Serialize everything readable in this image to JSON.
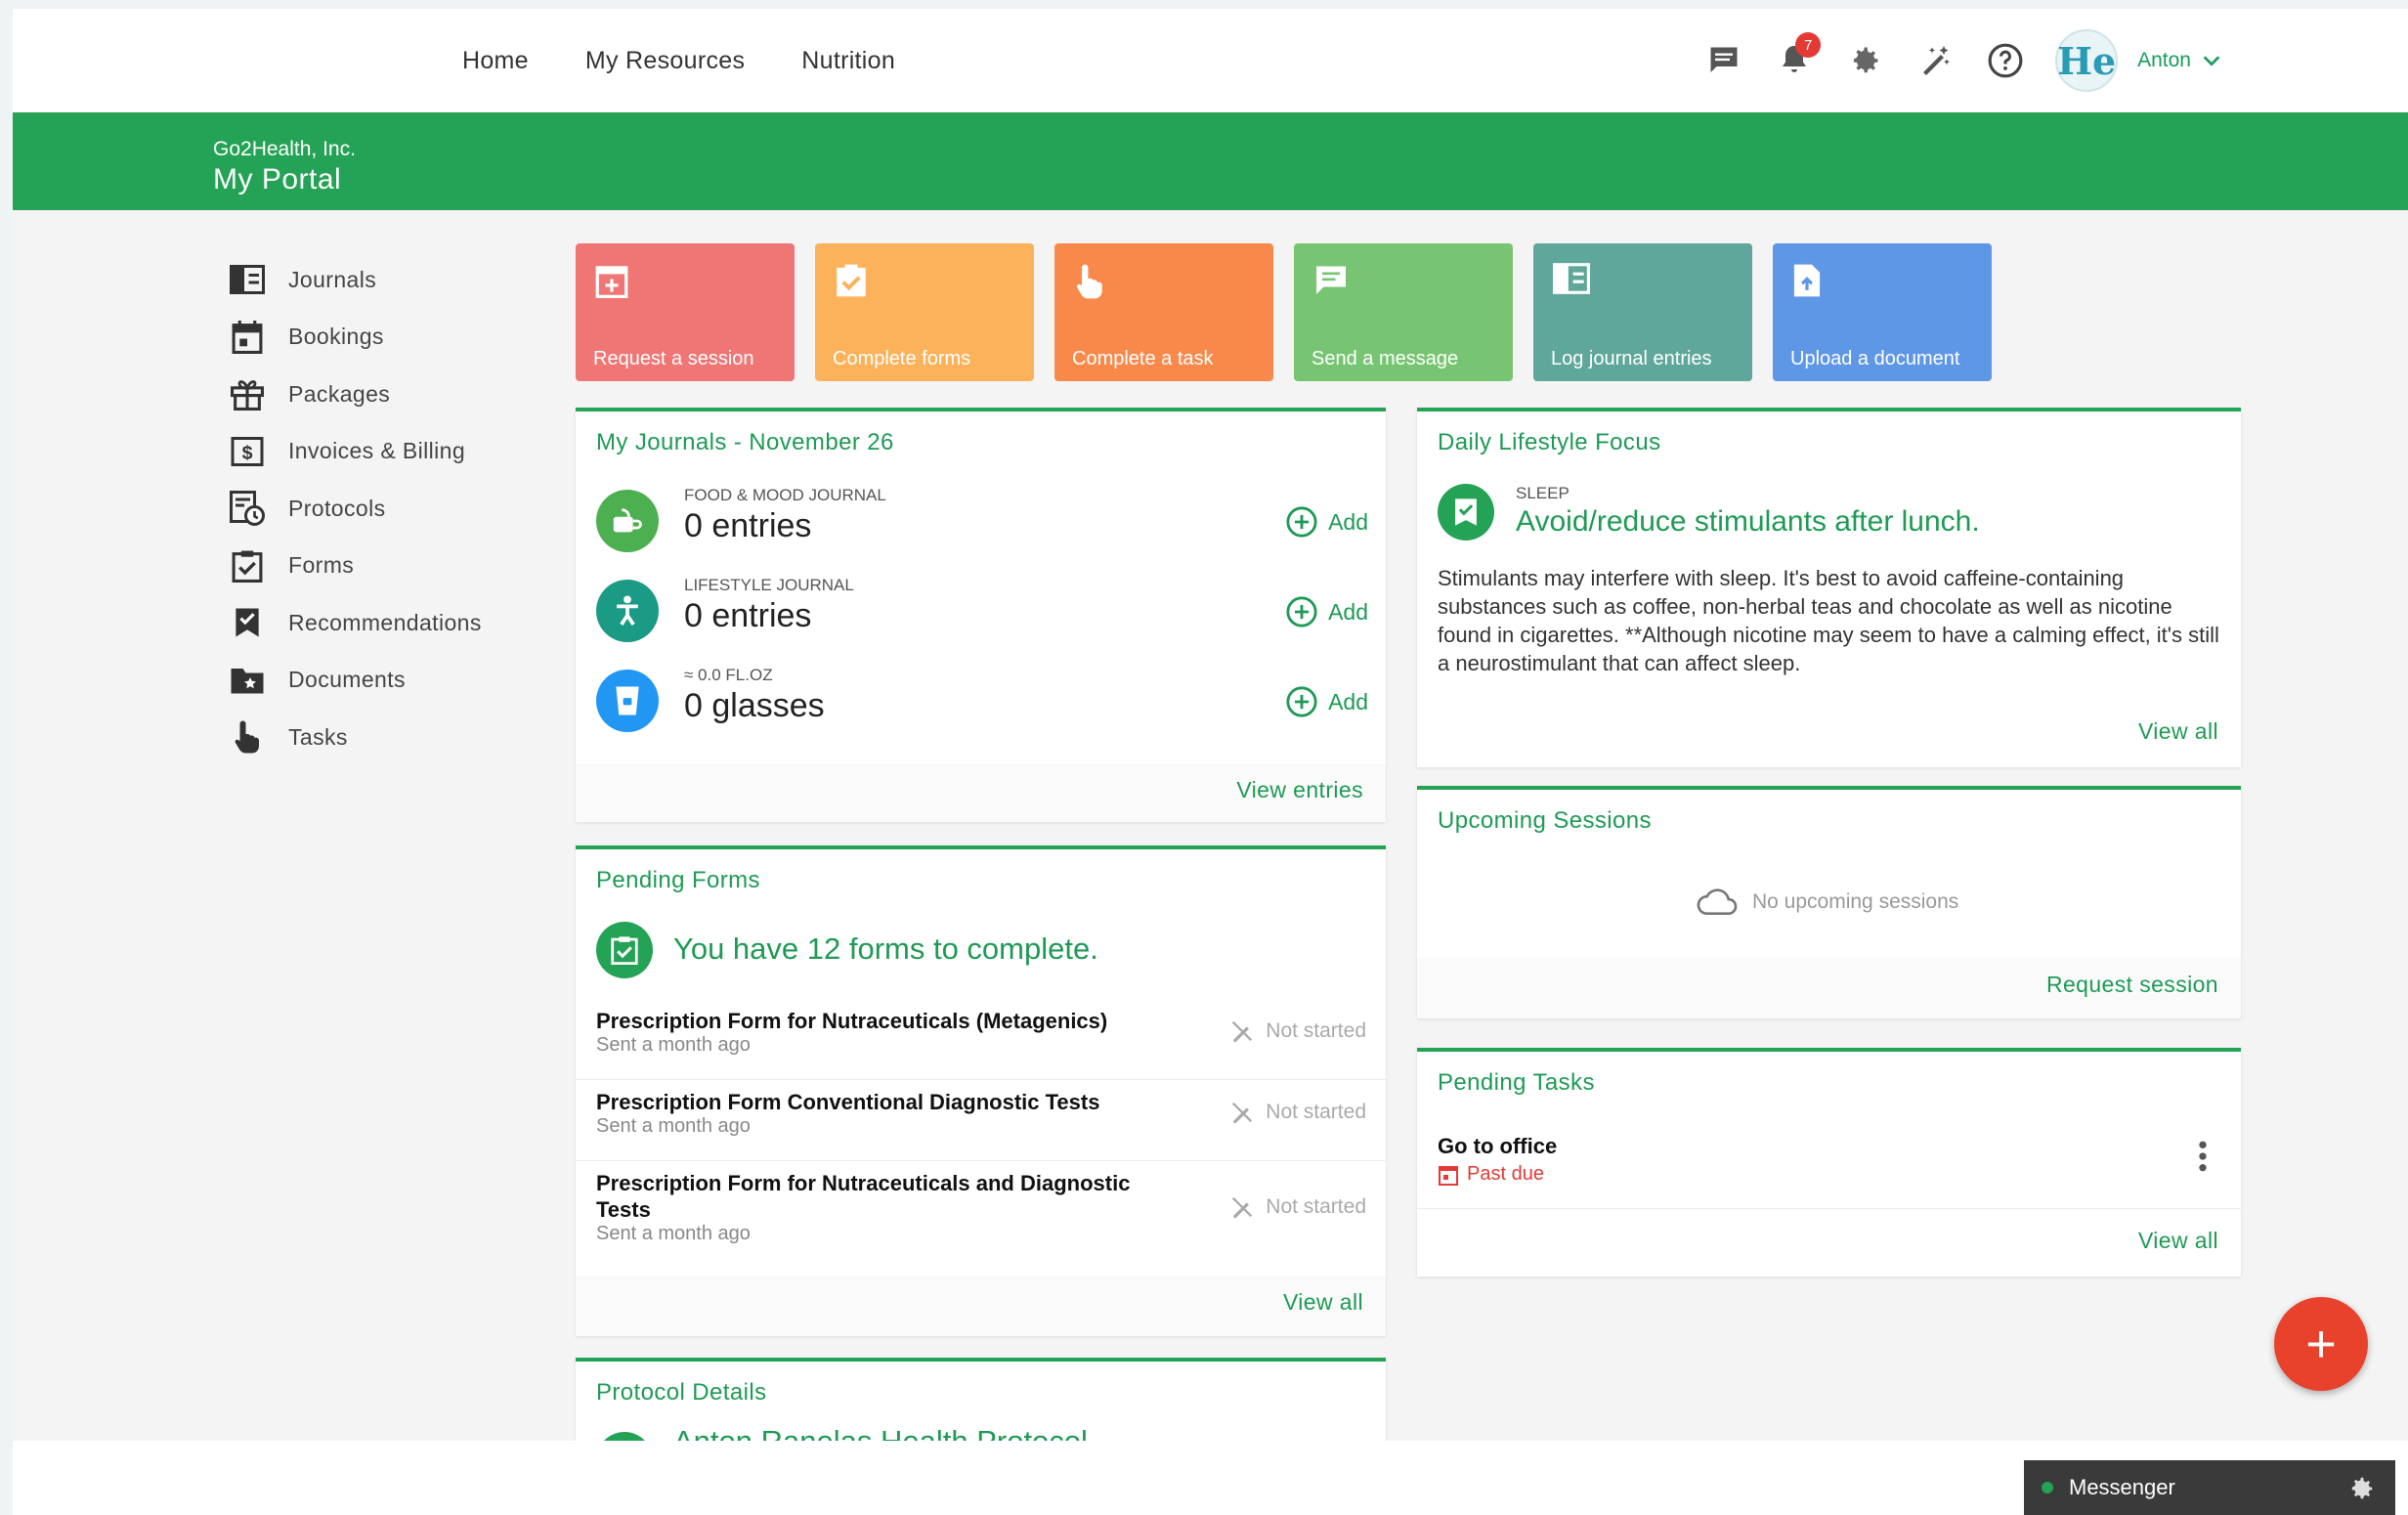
{
  "nav": {
    "links": [
      "Home",
      "My Resources",
      "Nutrition"
    ],
    "notifications_count": "7",
    "avatar_text": "He",
    "user_name": "Anton"
  },
  "banner": {
    "org": "Go2Health, Inc.",
    "title": "My Portal"
  },
  "sidebar": {
    "items": [
      {
        "label": "Journals",
        "icon": "journal-icon"
      },
      {
        "label": "Bookings",
        "icon": "calendar-icon"
      },
      {
        "label": "Packages",
        "icon": "gift-icon"
      },
      {
        "label": "Invoices & Billing",
        "icon": "dollar-icon"
      },
      {
        "label": "Protocols",
        "icon": "protocol-icon"
      },
      {
        "label": "Forms",
        "icon": "clipboard-check-icon"
      },
      {
        "label": "Recommendations",
        "icon": "bookmark-check-icon"
      },
      {
        "label": "Documents",
        "icon": "folder-star-icon"
      },
      {
        "label": "Tasks",
        "icon": "hand-pointer-icon"
      }
    ]
  },
  "tiles": [
    {
      "label": "Request a session",
      "color": "#ef7674",
      "icon": "calendar-plus-icon"
    },
    {
      "label": "Complete forms",
      "color": "#fbb25a",
      "icon": "clipboard-check-icon"
    },
    {
      "label": "Complete a task",
      "color": "#f9894b",
      "icon": "hand-pointer-icon"
    },
    {
      "label": "Send a message",
      "color": "#77c573",
      "icon": "chat-icon"
    },
    {
      "label": "Log journal entries",
      "color": "#5fa79b",
      "icon": "journal-icon"
    },
    {
      "label": "Upload a document",
      "color": "#5f97e7",
      "icon": "file-upload-icon"
    }
  ],
  "journals": {
    "title": "My Journals - November 26",
    "rows": [
      {
        "caption": "FOOD & MOOD JOURNAL",
        "value": "0 entries",
        "color": "#4caf50",
        "icon": "food-icon",
        "add": "Add"
      },
      {
        "caption": "LIFESTYLE JOURNAL",
        "value": "0 entries",
        "color": "#1b9a85",
        "icon": "person-icon",
        "add": "Add"
      },
      {
        "caption": "≈ 0.0 FL.OZ",
        "value": "0 glasses",
        "color": "#2196f3",
        "icon": "water-glass-icon",
        "add": "Add"
      }
    ],
    "footer": "View entries"
  },
  "pending_forms": {
    "title": "Pending Forms",
    "summary": "You have 12 forms to complete.",
    "rows": [
      {
        "name": "Prescription Form for Nutraceuticals (Metagenics)",
        "sent": "Sent a month ago",
        "status": "Not started"
      },
      {
        "name": "Prescription Form Conventional Diagnostic Tests",
        "sent": "Sent a month ago",
        "status": "Not started"
      },
      {
        "name": "Prescription Form for Nutraceuticals and Diagnostic Tests",
        "sent": "Sent a month ago",
        "status": "Not started"
      }
    ],
    "footer": "View all"
  },
  "protocol": {
    "title": "Protocol Details",
    "item": "Anton Ranelas Health Protocol"
  },
  "lifestyle": {
    "title": "Daily Lifestyle Focus",
    "category": "SLEEP",
    "headline": "Avoid/reduce stimulants after lunch.",
    "body": "Stimulants may interfere with sleep. It's best to avoid caffeine-containing substances such as coffee, non-herbal teas and chocolate as well as nicotine found in cigarettes. **Although nicotine may seem to have a calming effect, it's still a neurostimulant that can affect sleep.",
    "footer": "View all"
  },
  "sessions": {
    "title": "Upcoming Sessions",
    "empty": "No upcoming sessions",
    "footer": "Request session"
  },
  "tasks": {
    "title": "Pending Tasks",
    "rows": [
      {
        "name": "Go to office",
        "status": "Past due"
      }
    ],
    "footer": "View all"
  },
  "messenger": {
    "label": "Messenger"
  },
  "fab": {
    "label": "+"
  }
}
